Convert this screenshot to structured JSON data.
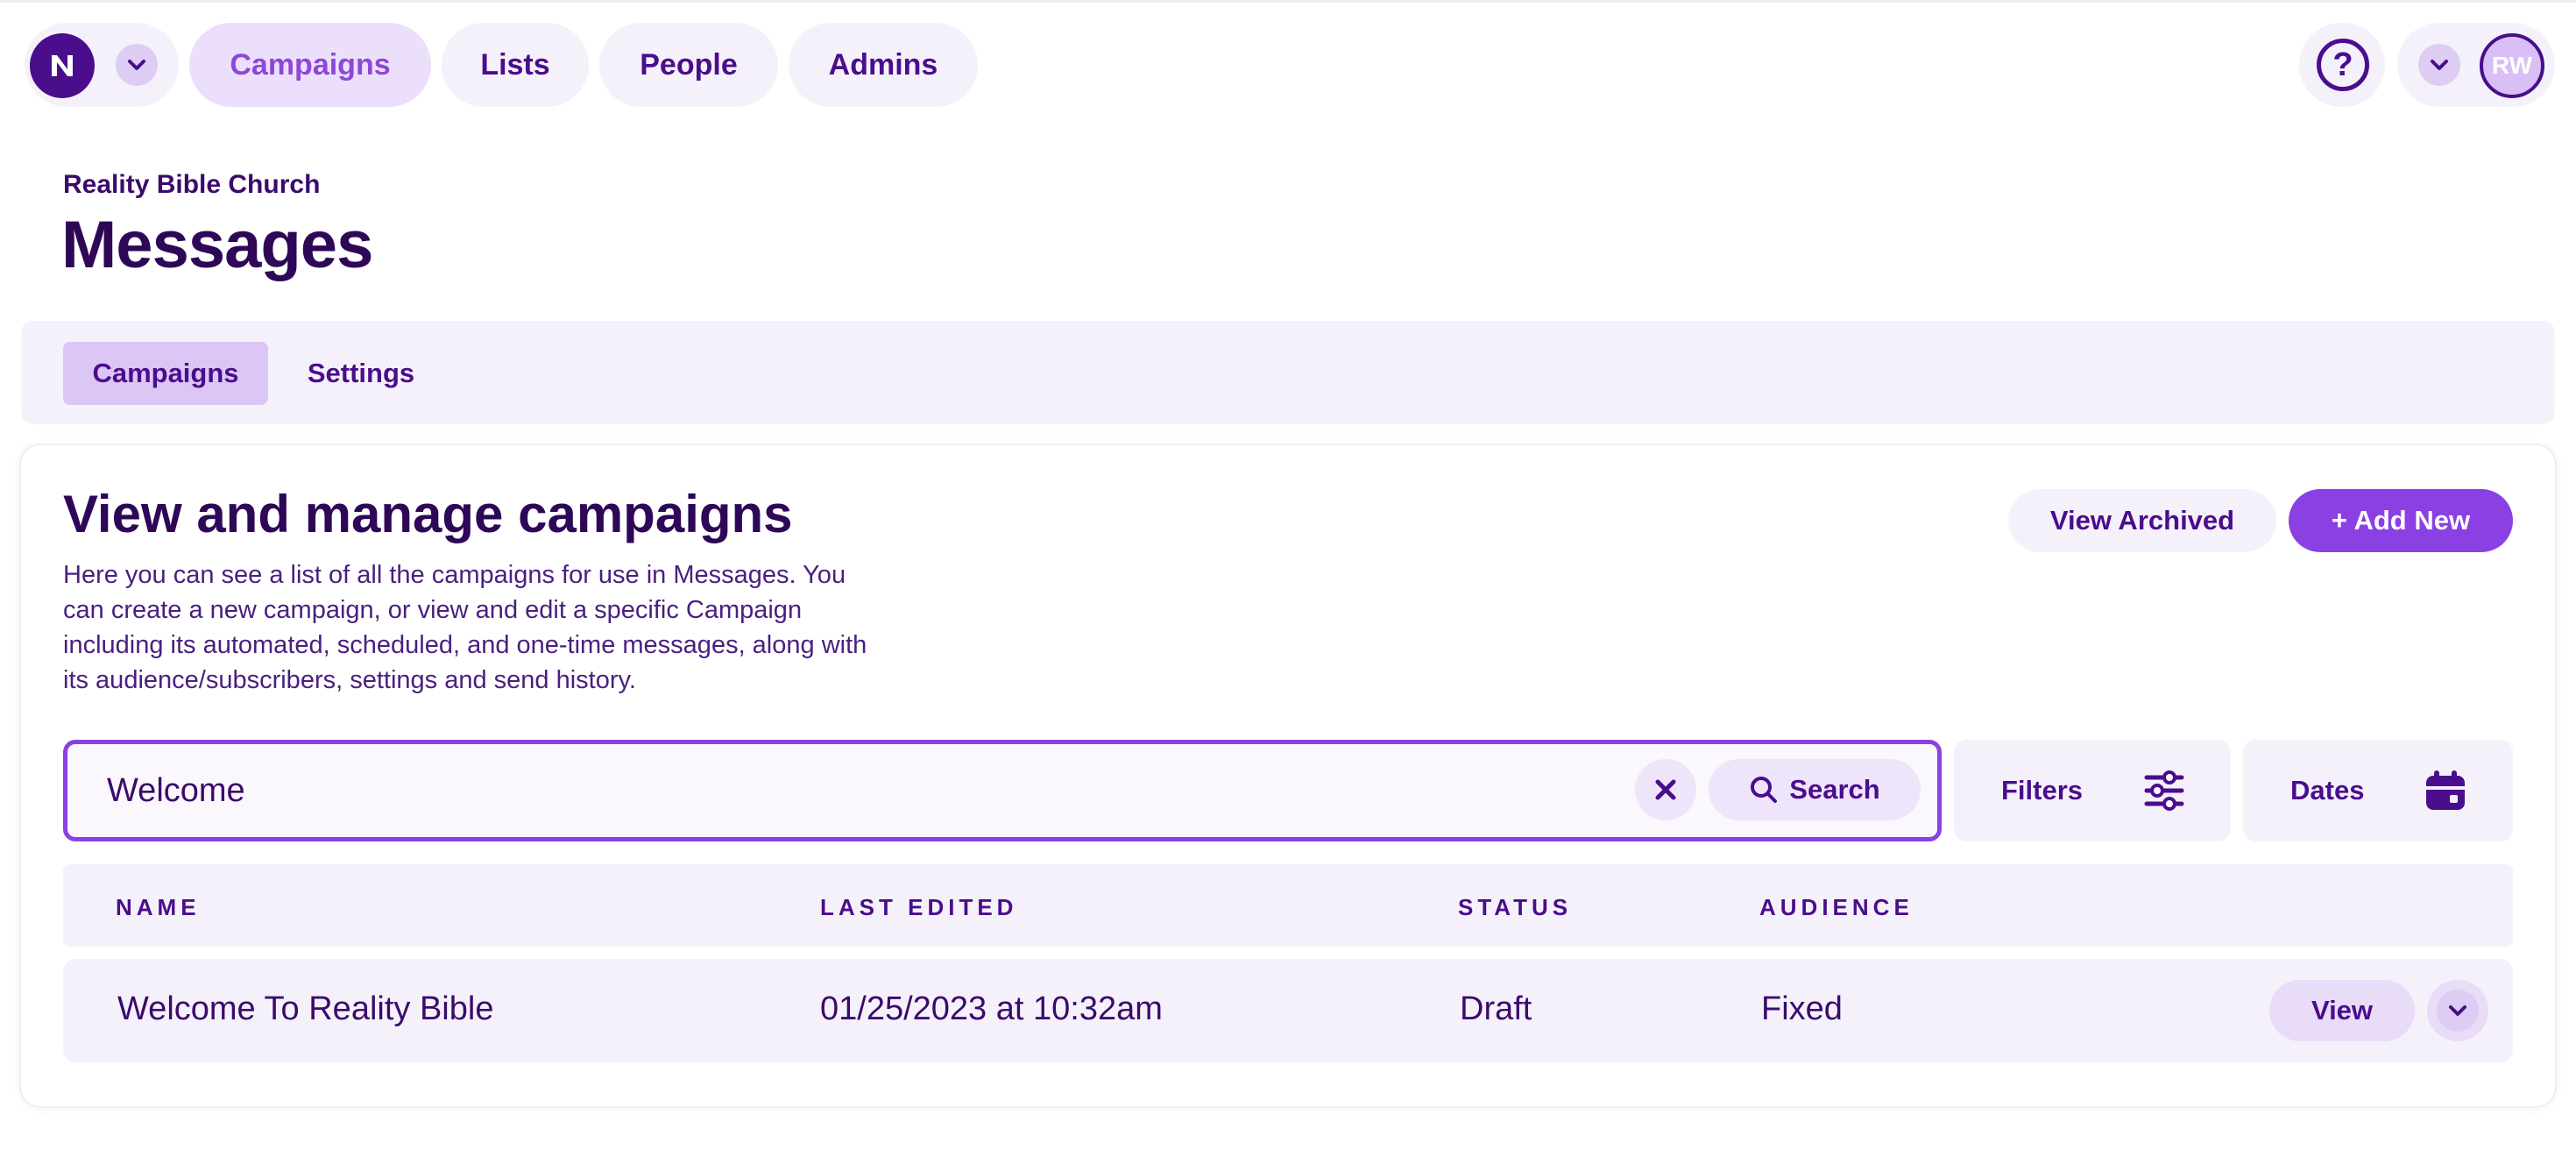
{
  "org": {
    "logo_letter": "N"
  },
  "nav": {
    "tabs": [
      {
        "label": "Campaigns",
        "active": true
      },
      {
        "label": "Lists"
      },
      {
        "label": "People"
      },
      {
        "label": "Admins"
      }
    ]
  },
  "header_right": {
    "help_label": "?",
    "user_initials": "RW"
  },
  "page": {
    "org_name": "Reality Bible Church",
    "title": "Messages"
  },
  "subtabs": [
    {
      "label": "Campaigns",
      "active": true
    },
    {
      "label": "Settings"
    }
  ],
  "card": {
    "title": "View and manage campaigns",
    "description": "Here you can see a list of all the campaigns for use in Messages. You can create a new campaign, or view and edit a specific Campaign including its automated, scheduled, and one-time messages, along with its audience/subscribers, settings and send history.",
    "view_archived_label": "View Archived",
    "add_new_label": "+ Add New"
  },
  "search": {
    "value": "Welcome",
    "button_label": "Search",
    "filters_label": "Filters",
    "dates_label": "Dates"
  },
  "table": {
    "columns": [
      "NAME",
      "LAST EDITED",
      "STATUS",
      "AUDIENCE"
    ],
    "rows": [
      {
        "name": "Welcome To Reality Bible",
        "last_edited": "01/25/2023 at 10:32am",
        "status": "Draft",
        "audience": "Fixed",
        "view_label": "View"
      }
    ]
  },
  "colors": {
    "brand_dark": "#4a0d8c",
    "accent": "#8a40e3",
    "surface": "#f5f1fb",
    "active_tab": "#ecdffb"
  }
}
